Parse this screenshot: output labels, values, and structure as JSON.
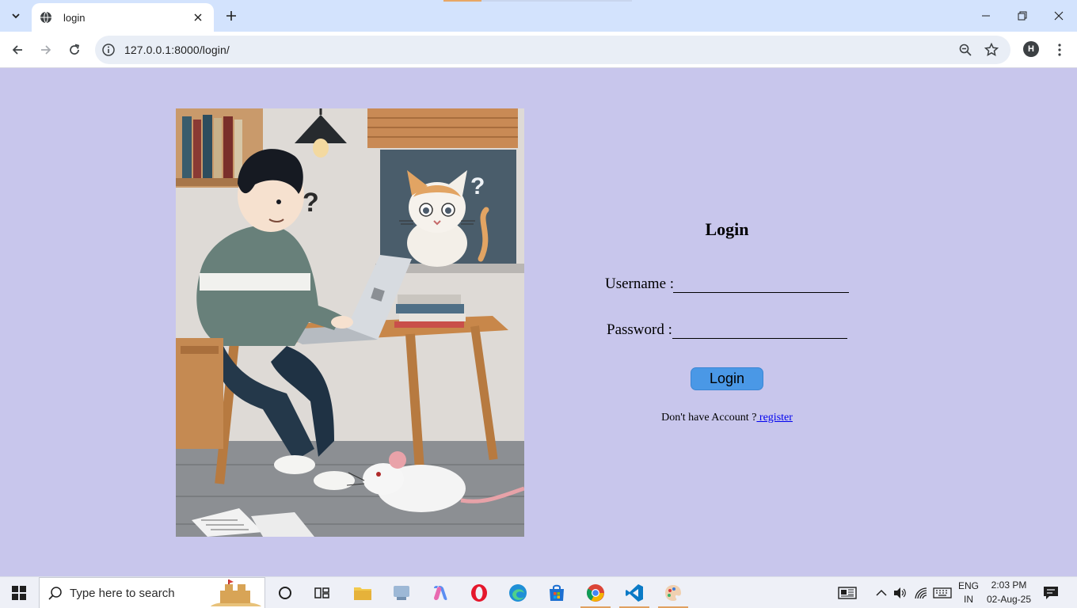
{
  "browser": {
    "tab_title": "login",
    "url": "127.0.0.1:8000/login/",
    "profile_initial": "H"
  },
  "page": {
    "title": "Login",
    "username_label": "Username :",
    "password_label": "Password :",
    "login_button": "Login",
    "signup_prompt": "Don't have Account ?",
    "register_link": " register",
    "background_color": "#c8c6ec",
    "button_color": "#4a98e6"
  },
  "taskbar": {
    "search_placeholder": "Type here to search",
    "language_line1": "ENG",
    "language_line2": "IN",
    "time": "2:03 PM",
    "date": "02-Aug-25",
    "apps": [
      "task-view-icon",
      "file-explorer-icon",
      "browser-icon",
      "copilot-icon",
      "opera-icon",
      "edge-icon",
      "store-icon",
      "chrome-icon",
      "vscode-icon",
      "paint-icon"
    ]
  }
}
